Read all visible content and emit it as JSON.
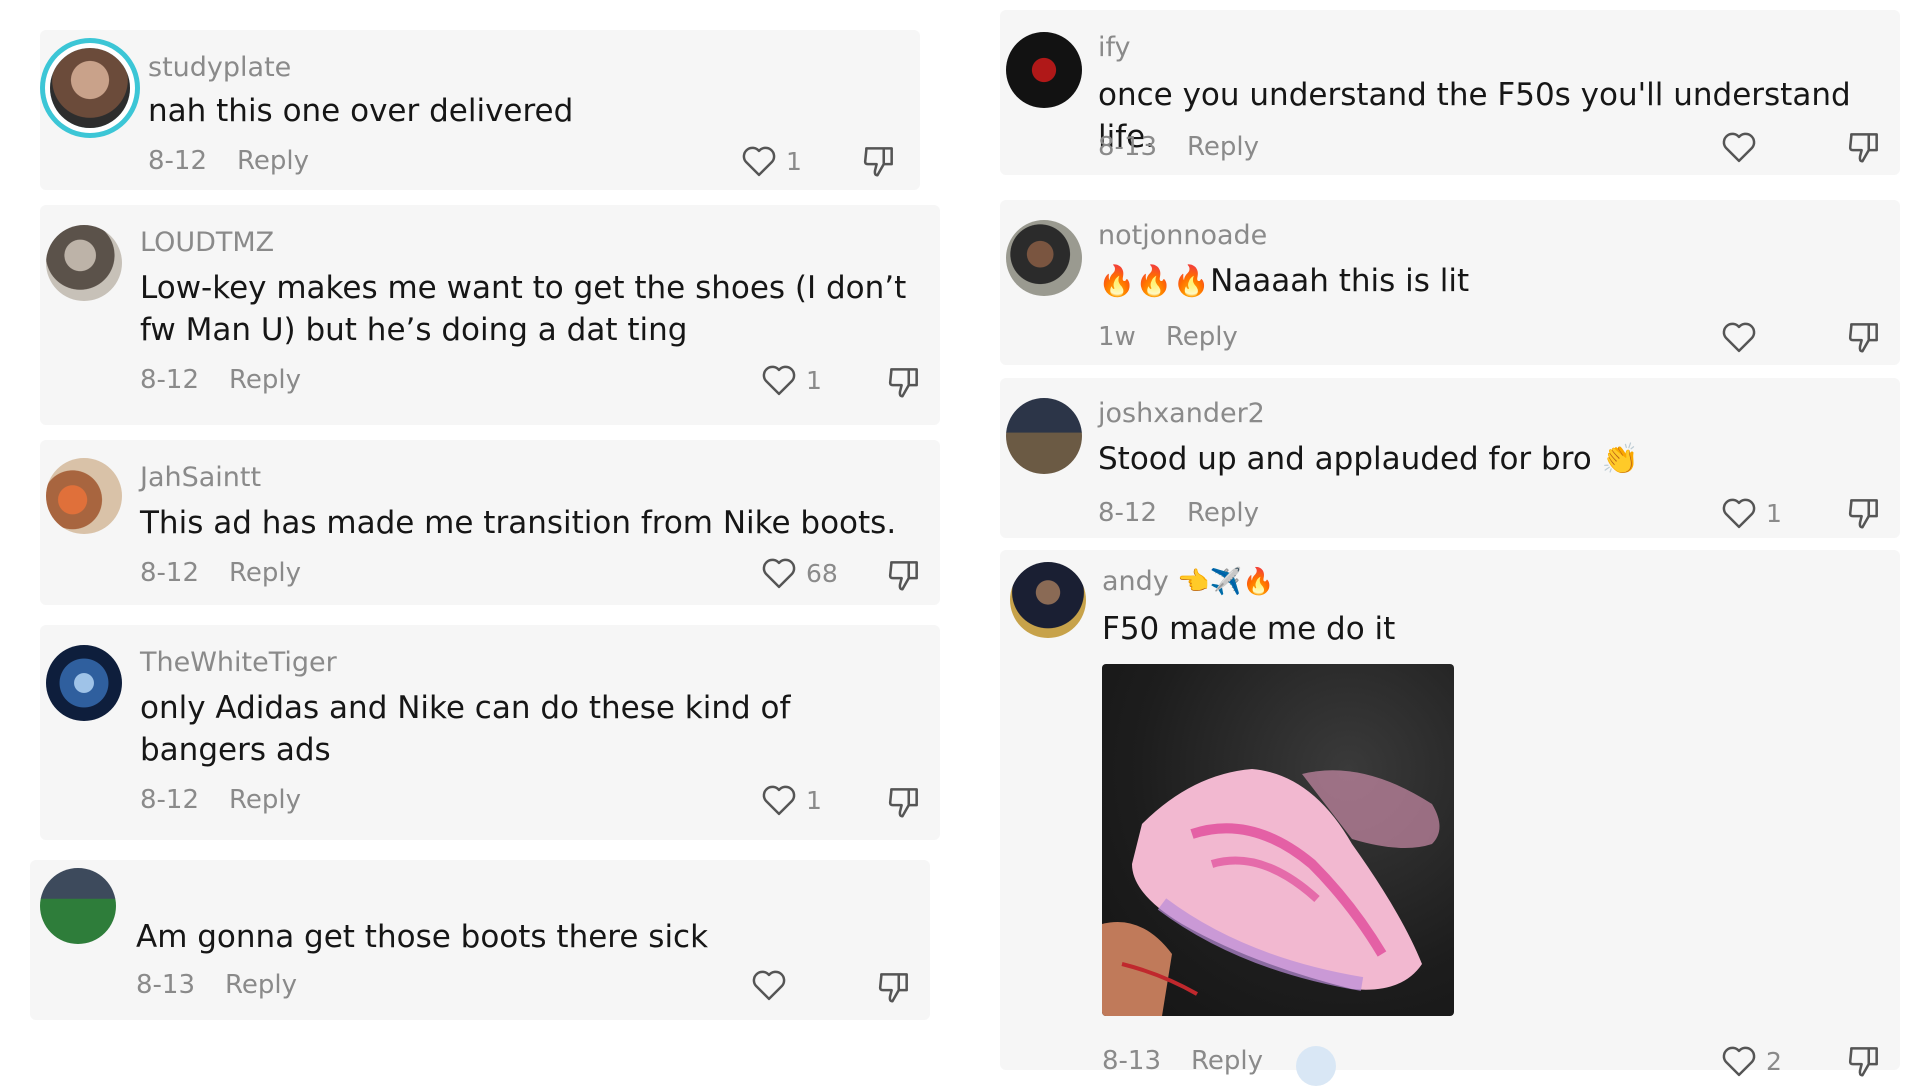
{
  "left_comments": [
    {
      "username": "studyplate",
      "text": "nah this one over delivered",
      "date": "8-12",
      "reply": "Reply",
      "likes": "1"
    },
    {
      "username": "LOUDTMZ",
      "text": "Low-key makes me want to get the shoes (I don’t fw Man U) but he’s doing a dat ting",
      "date": "8-12",
      "reply": "Reply",
      "likes": "1"
    },
    {
      "username": "JahSaintt",
      "text": "This ad has made me transition from Nike boots.",
      "date": "8-12",
      "reply": "Reply",
      "likes": "68"
    },
    {
      "username": "TheWhiteTiger",
      "text": "only Adidas and Nike can do these kind of bangers ads",
      "date": "8-12",
      "reply": "Reply",
      "likes": "1"
    },
    {
      "username": "",
      "text": "Am gonna get those boots there sick",
      "date": "8-13",
      "reply": "Reply",
      "likes": ""
    }
  ],
  "right_comments": [
    {
      "username": "ify",
      "text": "once you understand the F50s you'll understand life.",
      "date": "8-13",
      "reply": "Reply",
      "likes": ""
    },
    {
      "username": "notjonnoade",
      "emoji": "🔥🔥🔥",
      "text": "Naaaah this is lit",
      "date": "1w",
      "reply": "Reply",
      "likes": ""
    },
    {
      "username": "joshxander2",
      "text": "Stood up and applauded for bro",
      "emoji": "👏",
      "date": "8-12",
      "reply": "Reply",
      "likes": "1"
    },
    {
      "username": "andy",
      "emoji": "👈✈️🔥",
      "text": "F50 made me do it",
      "date": "8-13",
      "reply": "Reply",
      "likes": "2"
    }
  ],
  "icons": {
    "like": "heart-outline-icon",
    "dislike": "thumbs-down-icon"
  },
  "colors": {
    "text": "#161616",
    "muted": "#8a8a8a",
    "card": "#f6f6f6",
    "ring": "#3cc6d6"
  }
}
